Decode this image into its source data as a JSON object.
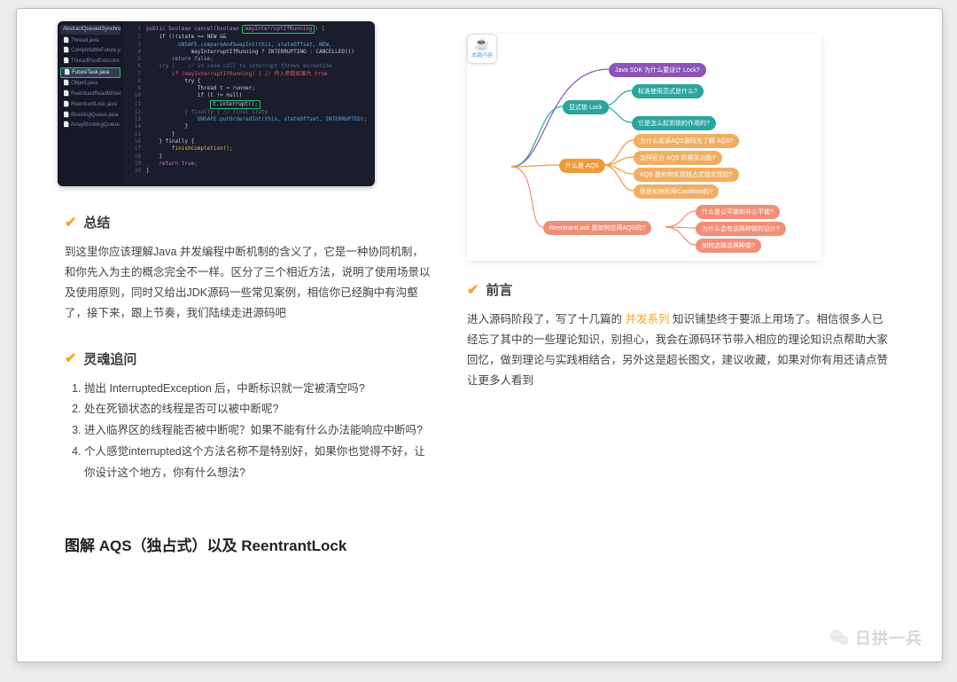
{
  "code": {
    "tab": "AbstractQueuedSynchronizer.java",
    "files": [
      "Thread.java",
      "CompletableFuture.java",
      "ThreadPoolExecutor.java",
      "FutureTask.java",
      "Object.java",
      "ReentrantReadWriteLock.java",
      "ReentrantLock.java",
      "BlockingQueue.java",
      "ArrayBlockingQueue.java"
    ],
    "active_index": 3,
    "lines": [
      {
        "g": "",
        "t": "public boolean cancel(boolean mayInterruptIfRunning) {",
        "cls": "kw",
        "box": "mayInterruptIfRunning"
      },
      {
        "g": "",
        "t": "    if (!(state == NEW &&"
      },
      {
        "g": "",
        "t": "          UNSAFE.compareAndSwapInt(this, stateOffset, NEW,",
        "cls": "bl"
      },
      {
        "g": "",
        "t": "              mayInterruptIfRunning ? INTERRUPTING : CANCELLED)))"
      },
      {
        "g": "",
        "t": "        return false;",
        "cls": "kw"
      },
      {
        "g": "",
        "t": "    try {    // in case call to interrupt throws exception",
        "cls": "cm"
      },
      {
        "g": "",
        "t": "        if (mayInterruptIfRunning) { // 传入参数如果为 true",
        "cls": "red"
      },
      {
        "g": "",
        "t": "            try {"
      },
      {
        "g": "",
        "t": "                Thread t = runner;"
      },
      {
        "g": "",
        "t": "                if (t != null)",
        "box2": "t.interrupt();"
      },
      {
        "g": "",
        "t": "                    t.interrupt();"
      },
      {
        "g": "",
        "t": "            } finally { // final state",
        "cls": "cm"
      },
      {
        "g": "",
        "t": "                UNSAFE.putOrderedInt(this, stateOffset, INTERRUPTED);",
        "cls": "bl"
      },
      {
        "g": "",
        "t": "            }"
      },
      {
        "g": "",
        "t": "        }"
      },
      {
        "g": "",
        "t": "    } finally {"
      },
      {
        "g": "",
        "t": "        finishCompletion();",
        "cls": "fn"
      },
      {
        "g": "",
        "t": "    }"
      },
      {
        "g": "",
        "t": "    return true;",
        "cls": "kw"
      },
      {
        "g": "",
        "t": "}"
      }
    ]
  },
  "left": {
    "summary_h": "总结",
    "summary_p": "到这里你应该理解Java 并发编程中断机制的含义了，它是一种协同机制，和你先入为主的概念完全不一样。区分了三个相近方法，说明了使用场景以及使用原则，同时又给出JDK源码一些常见案例，相信你已经胸中有沟壑了，接下来，跟上节奏，我们陆续走进源码吧",
    "soul_h": "灵魂追问",
    "questions": [
      "抛出 InterruptedException 后，中断标识就一定被清空吗?",
      "处在死锁状态的线程是否可以被中断呢?",
      "进入临界区的线程能否被中断呢？如果不能有什么办法能响应中断吗?",
      "个人感觉interrupted这个方法名称不是特别好，如果你也觉得不好，让你设计这个地方，你有什么想法?"
    ],
    "big_h": "图解 AQS（独占式）以及 ReentrantLock"
  },
  "right": {
    "preface_h": "前言",
    "preface_pre": "进入源码阶段了，写了十几篇的 ",
    "preface_link": "并发系列",
    "preface_post": " 知识铺垫终于要派上用场了。相信很多人已经忘了其中的一些理论知识，别担心，我会在源码环节带入相应的理论知识点帮助大家回忆，做到理论与实践相结合，另外这是超长图文，建议收藏，如果对你有用还请点赞让更多人看到"
  },
  "mindmap": {
    "root_label": "本篇内容",
    "purple": "Java SDK 为什么要设计 Lock?",
    "lock": "显式锁 Lock",
    "teal1": "标准使用范式是什么?",
    "teal2": "它是怎么起到锁的作用的?",
    "aqs": "什么是 AQS",
    "or1": "为什么阅读AQS源码先了解 AQS?",
    "or2": "怎样区分 AQS 的相关功能?",
    "or3": "AQS 是如何实现独占式锁实现的?",
    "or4": "锁是如何利用Condition的?",
    "reentrant": "ReentrantLock 是如何应用AQS的?",
    "sal1": "什么是公平锁和非公平锁?",
    "sal2": "为什么会有这两种锁的设计?",
    "sal3": "如何选择这两种锁?"
  },
  "watermark": "日拱一兵"
}
